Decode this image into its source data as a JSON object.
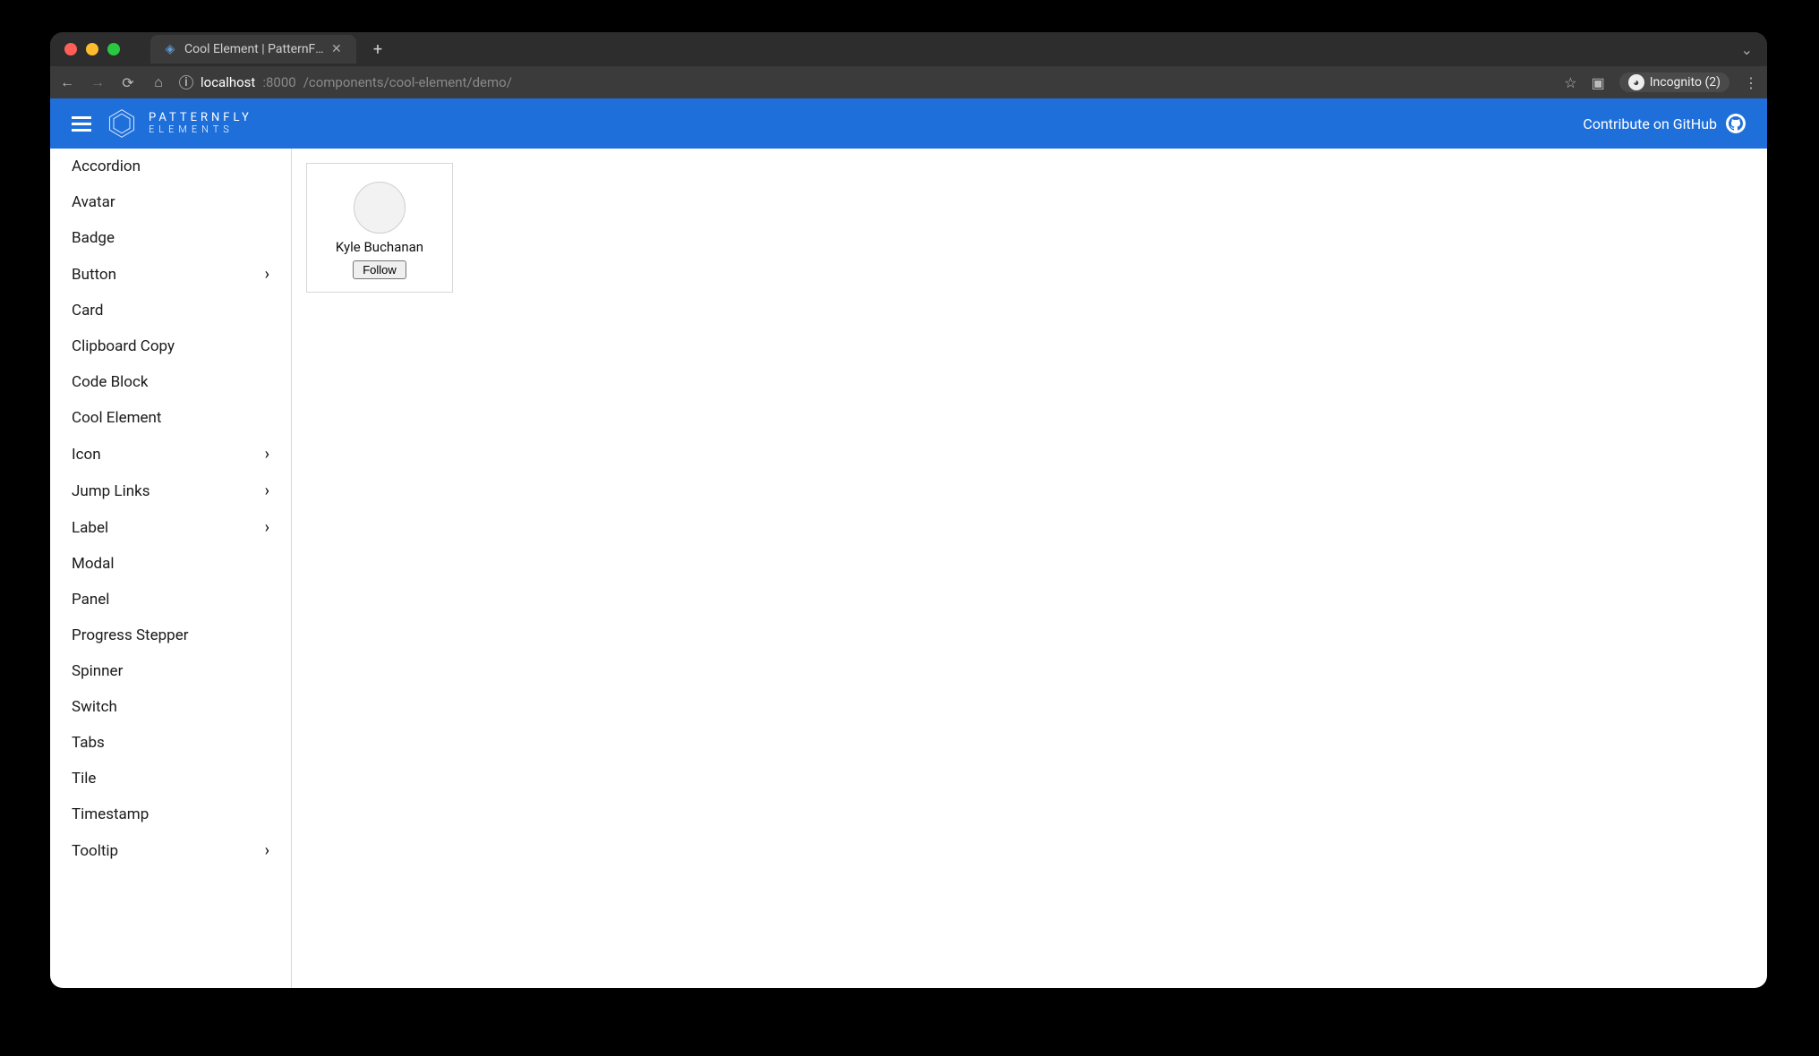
{
  "browser": {
    "tab_title": "Cool Element | PatternFly Elem...",
    "url_host": "localhost",
    "url_port": ":8000",
    "url_path": "/components/cool-element/demo/",
    "incognito_label": "Incognito (2)"
  },
  "header": {
    "logo_line1": "PATTERNFLY",
    "logo_line2": "ELEMENTS",
    "contribute": "Contribute on GitHub"
  },
  "sidebar": {
    "items": [
      {
        "label": "Accordion",
        "expandable": false
      },
      {
        "label": "Avatar",
        "expandable": false
      },
      {
        "label": "Badge",
        "expandable": false
      },
      {
        "label": "Button",
        "expandable": true
      },
      {
        "label": "Card",
        "expandable": false
      },
      {
        "label": "Clipboard Copy",
        "expandable": false
      },
      {
        "label": "Code Block",
        "expandable": false
      },
      {
        "label": "Cool Element",
        "expandable": false
      },
      {
        "label": "Icon",
        "expandable": true
      },
      {
        "label": "Jump Links",
        "expandable": true
      },
      {
        "label": "Label",
        "expandable": true
      },
      {
        "label": "Modal",
        "expandable": false
      },
      {
        "label": "Panel",
        "expandable": false
      },
      {
        "label": "Progress Stepper",
        "expandable": false
      },
      {
        "label": "Spinner",
        "expandable": false
      },
      {
        "label": "Switch",
        "expandable": false
      },
      {
        "label": "Tabs",
        "expandable": false
      },
      {
        "label": "Tile",
        "expandable": false
      },
      {
        "label": "Timestamp",
        "expandable": false
      },
      {
        "label": "Tooltip",
        "expandable": true
      }
    ]
  },
  "profile": {
    "name": "Kyle Buchanan",
    "follow_label": "Follow"
  }
}
